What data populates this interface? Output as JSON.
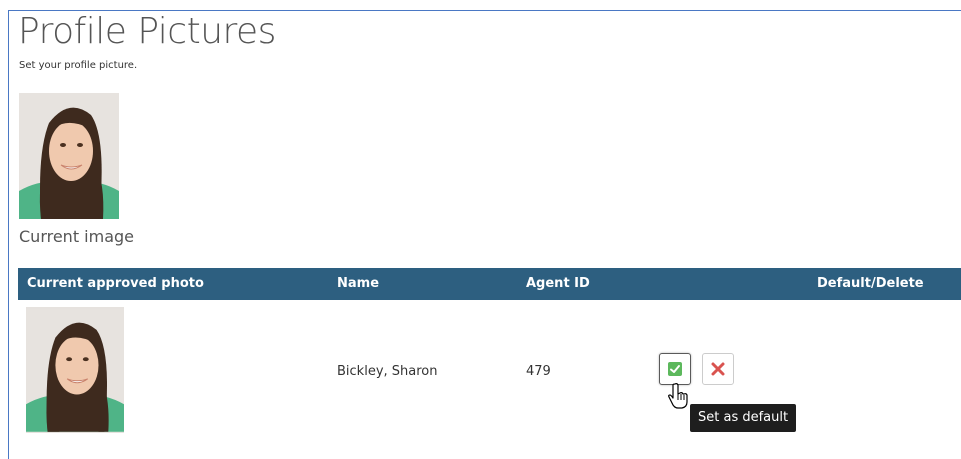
{
  "page": {
    "title": "Profile Pictures",
    "subtitle": "Set your profile picture."
  },
  "current": {
    "photo_icon": "profile-photo",
    "label": "Current image"
  },
  "table": {
    "columns": [
      "Current approved photo",
      "Name",
      "Agent ID",
      "Default/Delete"
    ],
    "rows": [
      {
        "photo_icon": "profile-photo",
        "name": "Bickley, Sharon",
        "agent_id": "479",
        "actions": {
          "default_icon": "check-icon",
          "delete_icon": "close-icon"
        }
      }
    ]
  },
  "tooltip": {
    "text": "Set as default"
  },
  "colors": {
    "header_bg": "#2d5f80",
    "check_green": "#5cb85c",
    "delete_red": "#d9534f",
    "tooltip_bg": "#1e1e1e"
  }
}
